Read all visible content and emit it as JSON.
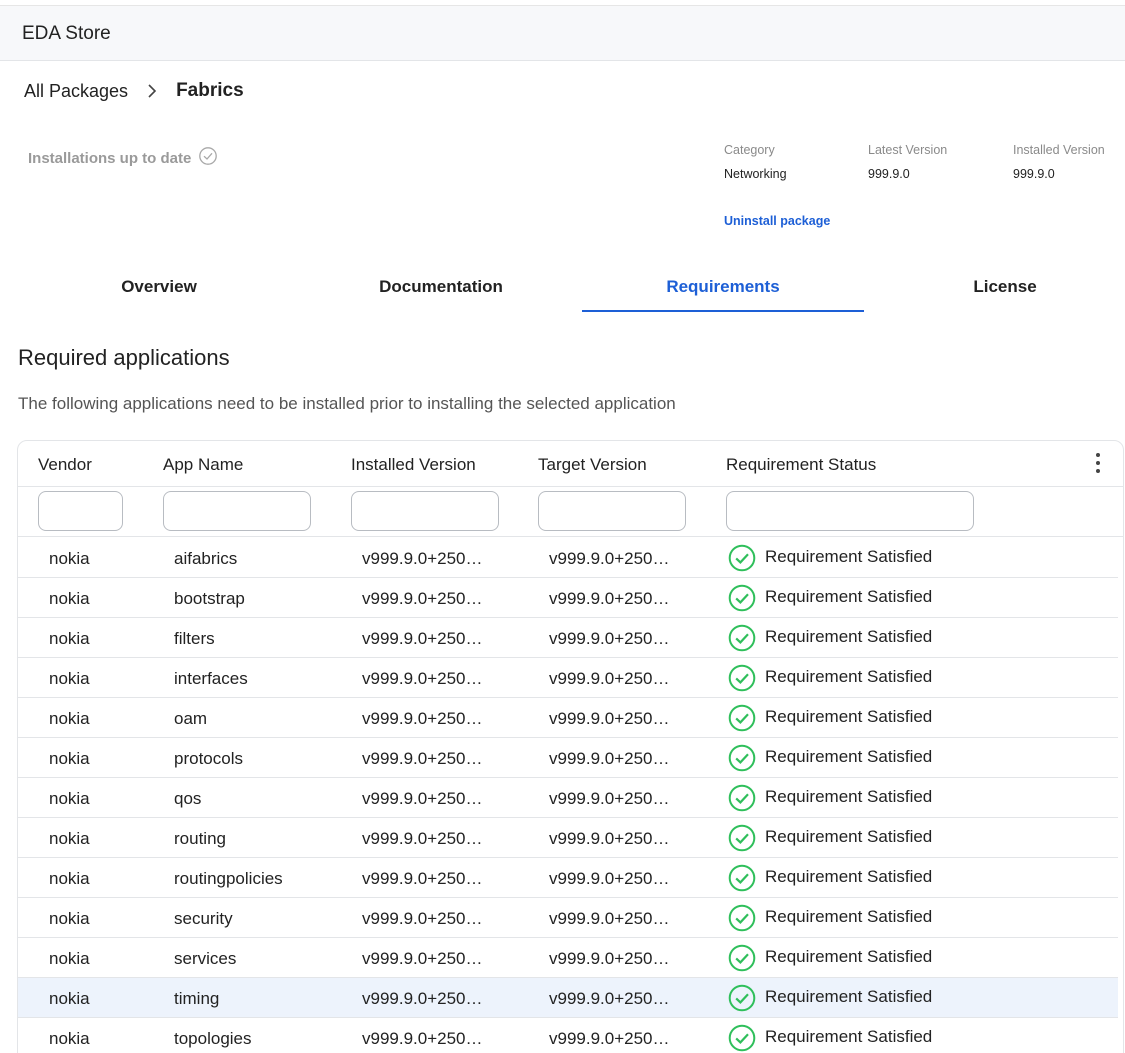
{
  "app": {
    "title": "EDA Store"
  },
  "breadcrumb": {
    "parent": "All Packages",
    "current": "Fabrics"
  },
  "status": {
    "text": "Installations up to date"
  },
  "meta": {
    "category_label": "Category",
    "category_value": "Networking",
    "latest_label": "Latest Version",
    "latest_value": "999.9.0",
    "installed_label": "Installed Version",
    "installed_value": "999.9.0",
    "uninstall_label": "Uninstall package"
  },
  "tabs": [
    {
      "label": "Overview",
      "active": false
    },
    {
      "label": "Documentation",
      "active": false
    },
    {
      "label": "Requirements",
      "active": true
    },
    {
      "label": "License",
      "active": false
    }
  ],
  "section": {
    "title": "Required applications",
    "description": "The following applications need to be installed prior to installing the selected application"
  },
  "table": {
    "columns": [
      "Vendor",
      "App Name",
      "Installed Version",
      "Target Version",
      "Requirement Status"
    ],
    "rows": [
      {
        "vendor": "nokia",
        "app": "aifabrics",
        "installed": "v999.9.0+250…",
        "target": "v999.9.0+250…",
        "status": "Requirement Satisfied"
      },
      {
        "vendor": "nokia",
        "app": "bootstrap",
        "installed": "v999.9.0+250…",
        "target": "v999.9.0+250…",
        "status": "Requirement Satisfied"
      },
      {
        "vendor": "nokia",
        "app": "filters",
        "installed": "v999.9.0+250…",
        "target": "v999.9.0+250…",
        "status": "Requirement Satisfied"
      },
      {
        "vendor": "nokia",
        "app": "interfaces",
        "installed": "v999.9.0+250…",
        "target": "v999.9.0+250…",
        "status": "Requirement Satisfied"
      },
      {
        "vendor": "nokia",
        "app": "oam",
        "installed": "v999.9.0+250…",
        "target": "v999.9.0+250…",
        "status": "Requirement Satisfied"
      },
      {
        "vendor": "nokia",
        "app": "protocols",
        "installed": "v999.9.0+250…",
        "target": "v999.9.0+250…",
        "status": "Requirement Satisfied"
      },
      {
        "vendor": "nokia",
        "app": "qos",
        "installed": "v999.9.0+250…",
        "target": "v999.9.0+250…",
        "status": "Requirement Satisfied"
      },
      {
        "vendor": "nokia",
        "app": "routing",
        "installed": "v999.9.0+250…",
        "target": "v999.9.0+250…",
        "status": "Requirement Satisfied"
      },
      {
        "vendor": "nokia",
        "app": "routingpolicies",
        "installed": "v999.9.0+250…",
        "target": "v999.9.0+250…",
        "status": "Requirement Satisfied"
      },
      {
        "vendor": "nokia",
        "app": "security",
        "installed": "v999.9.0+250…",
        "target": "v999.9.0+250…",
        "status": "Requirement Satisfied"
      },
      {
        "vendor": "nokia",
        "app": "services",
        "installed": "v999.9.0+250…",
        "target": "v999.9.0+250…",
        "status": "Requirement Satisfied"
      },
      {
        "vendor": "nokia",
        "app": "timing",
        "installed": "v999.9.0+250…",
        "target": "v999.9.0+250…",
        "status": "Requirement Satisfied",
        "highlighted": true
      },
      {
        "vendor": "nokia",
        "app": "topologies",
        "installed": "v999.9.0+250…",
        "target": "v999.9.0+250…",
        "status": "Requirement Satisfied"
      }
    ]
  },
  "colors": {
    "accent": "#1d5fd6",
    "success": "#2fbf5b",
    "row_highlight": "#edf3fc"
  },
  "icons": {
    "breadcrumb_separator": "chevron-right-icon",
    "status": "check-circle-icon",
    "row_status": "check-circle-icon",
    "column_menu": "kebab-menu-icon"
  }
}
